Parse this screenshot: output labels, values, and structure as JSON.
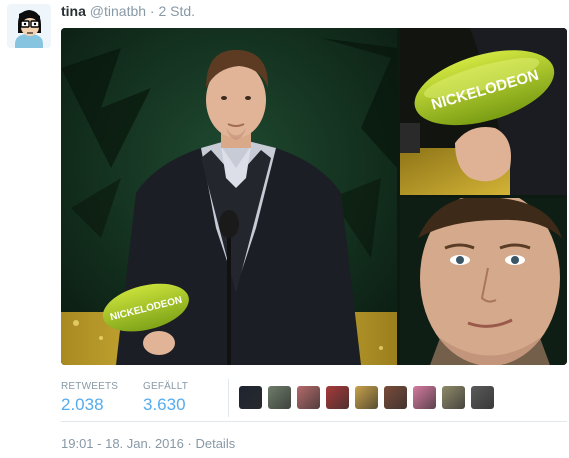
{
  "tweet": {
    "display_name": "tina",
    "handle": "@tinatbh",
    "separator": "·",
    "relative_time": "2 Std.",
    "image_labels": {
      "trophy_text": "NICKELODEON"
    },
    "stats": {
      "retweets_label": "RETWEETS",
      "retweets_value": "2.038",
      "likes_label": "GEFÄLLT",
      "likes_value": "3.630"
    },
    "liked_by_avatar_colors": [
      "#1e2430",
      "#6e7c6a",
      "#b56a6a",
      "#a83a3a",
      "#c9a24a",
      "#7a4b3a",
      "#d57aa0",
      "#8e8a6a",
      "#5a5a5a"
    ],
    "footer": {
      "timestamp": "19:01 - 18. Jan. 2016",
      "separator": "·",
      "details_link": "Details"
    }
  }
}
